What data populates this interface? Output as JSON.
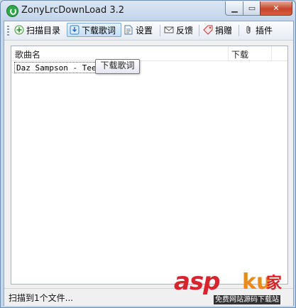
{
  "window": {
    "title": "ZonyLrcDownLoad 3.2"
  },
  "toolbar": {
    "scan_label": "扫描目录",
    "download_label": "下载歌词",
    "settings_label": "设置",
    "feedback_label": "反馈",
    "donate_label": "捐赠",
    "plugins_label": "插件"
  },
  "list": {
    "columns": [
      "歌曲名",
      "下载"
    ],
    "rows": [
      {
        "name": "Daz Sampson - Teen"
      }
    ]
  },
  "tooltip": {
    "text": "下载歌词"
  },
  "status": {
    "text": "扫描到1个文件..."
  },
  "watermark": {
    "brand_a": "asp",
    "brand_b": "ku",
    "brand_c": "家",
    "sub": "免费网站源码下载站"
  },
  "colors": {
    "accent": "#7ea9d6",
    "close": "#c7452a",
    "brand_red": "#d8242c",
    "brand_orange": "#e88a1e"
  }
}
